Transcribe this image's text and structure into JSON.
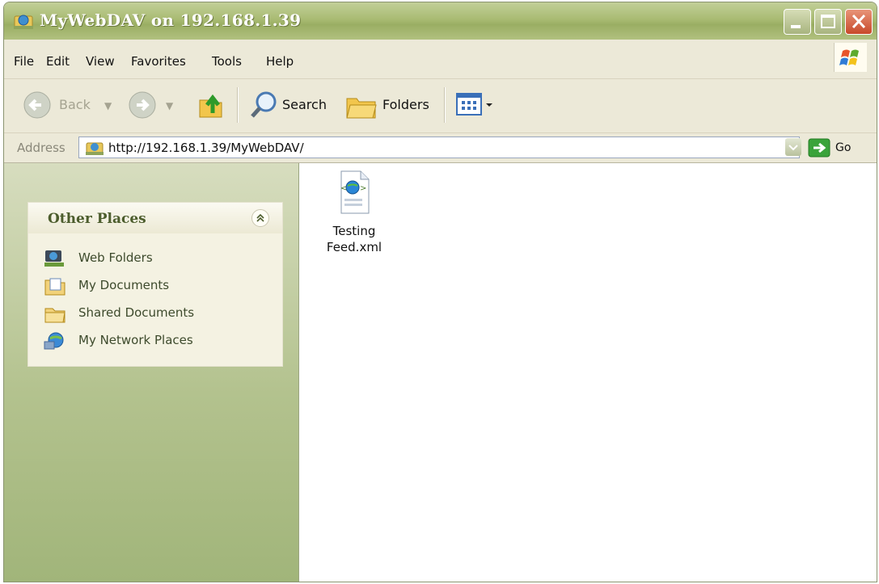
{
  "window": {
    "title": "MyWebDAV on 192.168.1.39"
  },
  "menu": {
    "items": [
      "File",
      "Edit",
      "View",
      "Favorites",
      "Tools",
      "Help"
    ]
  },
  "toolbar": {
    "back_label": "Back",
    "search_label": "Search",
    "folders_label": "Folders"
  },
  "address": {
    "label": "Address",
    "value": "http://192.168.1.39/MyWebDAV/",
    "go_label": "Go"
  },
  "task_pane": {
    "other_places": {
      "title": "Other Places",
      "items": [
        {
          "label": "Web Folders",
          "icon": "web-folders-icon"
        },
        {
          "label": "My Documents",
          "icon": "my-documents-icon"
        },
        {
          "label": "Shared Documents",
          "icon": "shared-documents-icon"
        },
        {
          "label": "My Network Places",
          "icon": "network-places-icon"
        }
      ]
    }
  },
  "files": [
    {
      "name": "Testing\nFeed.xml",
      "icon": "xml-file-icon"
    }
  ],
  "colors": {
    "title_bar": "#a9bb73",
    "task_pane": "#b3c28e",
    "panel_title": "#4c5d2d",
    "content_bg": "#ffffff"
  }
}
